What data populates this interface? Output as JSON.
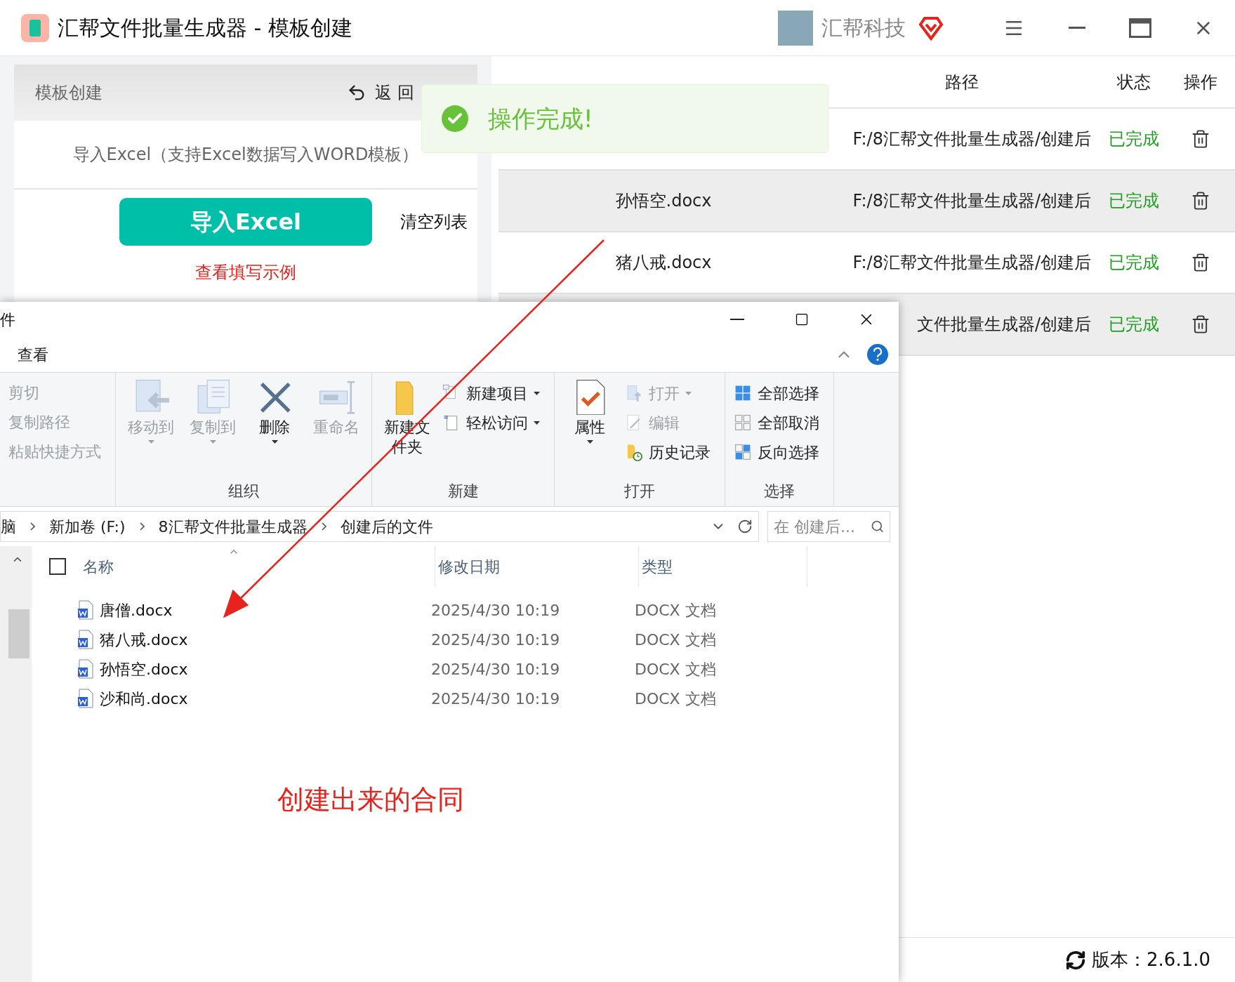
{
  "app": {
    "title": "汇帮文件批量生成器 - 模板创建",
    "brand": "汇帮科技"
  },
  "left_panel": {
    "header": "模板创建",
    "back_button": "返 回",
    "import_hint": "导入Excel（支持Excel数据写入WORD模板）",
    "import_button": "导入Excel",
    "clear_button": "清空列表",
    "example_link": "查看填写示例"
  },
  "toast": {
    "message": "操作完成!"
  },
  "table": {
    "columns": [
      "路径",
      "状态",
      "操作"
    ],
    "rows": [
      {
        "path": "F:/8汇帮文件批量生成器/创建后",
        "status": "已完成"
      },
      {
        "name": "孙悟空.docx",
        "path": "F:/8汇帮文件批量生成器/创建后",
        "status": "已完成"
      },
      {
        "name": "猪八戒.docx",
        "path": "F:/8汇帮文件批量生成器/创建后",
        "status": "已完成"
      },
      {
        "path": "文件批量生成器/创建后",
        "status": "已完成"
      }
    ]
  },
  "version": "版本：2.6.1.0",
  "explorer": {
    "title": "件",
    "tab": "查看",
    "ribbon": [
      {
        "items": [
          {
            "kind": "text",
            "label": "剪切",
            "disabled": true
          },
          {
            "kind": "text",
            "label": "复制路径",
            "disabled": true
          },
          {
            "kind": "text",
            "label": "粘贴快捷方式",
            "disabled": true
          }
        ]
      },
      {
        "label": "组织",
        "items": [
          {
            "kind": "large",
            "label": "移动到",
            "dropdown": true,
            "disabled": true
          },
          {
            "kind": "large",
            "label": "复制到",
            "dropdown": true,
            "disabled": true
          },
          {
            "kind": "large",
            "label": "删除",
            "dropdown": true,
            "disabled": false
          },
          {
            "kind": "large",
            "label": "重命名",
            "dropdown": false,
            "disabled": true
          }
        ]
      },
      {
        "label": "新建",
        "items": [
          {
            "kind": "large",
            "label": "新建文件夹",
            "dropdown": false,
            "disabled": false
          },
          {
            "kind": "small",
            "label": "新建项目",
            "dropdown": true,
            "disabled": false
          },
          {
            "kind": "small",
            "label": "轻松访问",
            "dropdown": true,
            "disabled": false
          }
        ]
      },
      {
        "label": "打开",
        "items": [
          {
            "kind": "large",
            "label": "属性",
            "dropdown": true,
            "disabled": false
          },
          {
            "kind": "small",
            "label": "打开",
            "dropdown": true,
            "disabled": true
          },
          {
            "kind": "small",
            "label": "编辑",
            "dropdown": false,
            "disabled": true
          },
          {
            "kind": "small",
            "label": "历史记录",
            "dropdown": false,
            "disabled": false
          }
        ]
      },
      {
        "label": "选择",
        "items": [
          {
            "kind": "small",
            "label": "全部选择",
            "dropdown": false,
            "disabled": false
          },
          {
            "kind": "small",
            "label": "全部取消",
            "dropdown": false,
            "disabled": false
          },
          {
            "kind": "small",
            "label": "反向选择",
            "dropdown": false,
            "disabled": false
          }
        ]
      }
    ],
    "breadcrumb": [
      "脑",
      "新加卷 (F:)",
      "8汇帮文件批量生成器",
      "创建后的文件"
    ],
    "search": {
      "placeholder": "在 创建后..."
    },
    "select_all": {
      "checked": false
    },
    "columns": [
      "名称",
      "修改日期",
      "类型"
    ],
    "files": [
      {
        "name": "唐僧.docx",
        "date": "2025/4/30 10:19",
        "type": "DOCX 文档"
      },
      {
        "name": "猪八戒.docx",
        "date": "2025/4/30 10:19",
        "type": "DOCX 文档"
      },
      {
        "name": "孙悟空.docx",
        "date": "2025/4/30 10:19",
        "type": "DOCX 文档"
      },
      {
        "name": "沙和尚.docx",
        "date": "2025/4/30 10:19",
        "type": "DOCX 文档"
      }
    ]
  },
  "annotation": "创建出来的合同"
}
